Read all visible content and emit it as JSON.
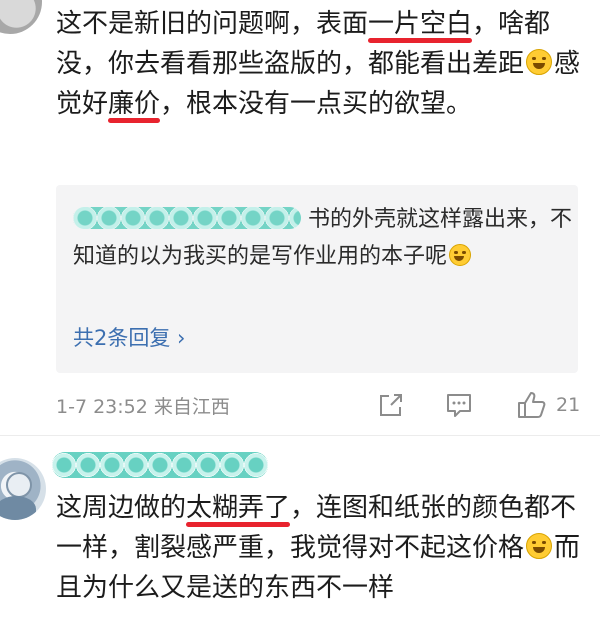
{
  "comment1": {
    "before_underline1": "这不是新旧的问题啊，表面",
    "underline1": "一片空白",
    "between": "，啥都没，你去看看那些盗版的，都能看出差距",
    "after_emoji": "感觉好",
    "underline2": "廉价",
    "rest": "，根本没有一点买的欲望。"
  },
  "reply": {
    "text_line1_suffix": "书的外壳就这样露",
    "text_rest": "出来，不知道的以为我买的是写作业用的本子呢",
    "more_replies": "共2条回复 ›"
  },
  "meta": {
    "timestamp": "1-7 23:52",
    "location": "来自江西",
    "like_count": "21"
  },
  "comment2": {
    "before_underline": "这周边做的",
    "underline": "太糊弄了",
    "after_underline": "，连图和纸张的颜色都不一样，割裂感严重，我觉得对不起这价格",
    "after_emoji": "而且为什么又是送的东西不一样"
  },
  "icons": {
    "share": "share-icon",
    "comment": "comment-icon",
    "like": "thumbs-up-icon",
    "laugh_emoji": "laughing-tears-emoji",
    "smirk_emoji": "smirk-emoji"
  }
}
